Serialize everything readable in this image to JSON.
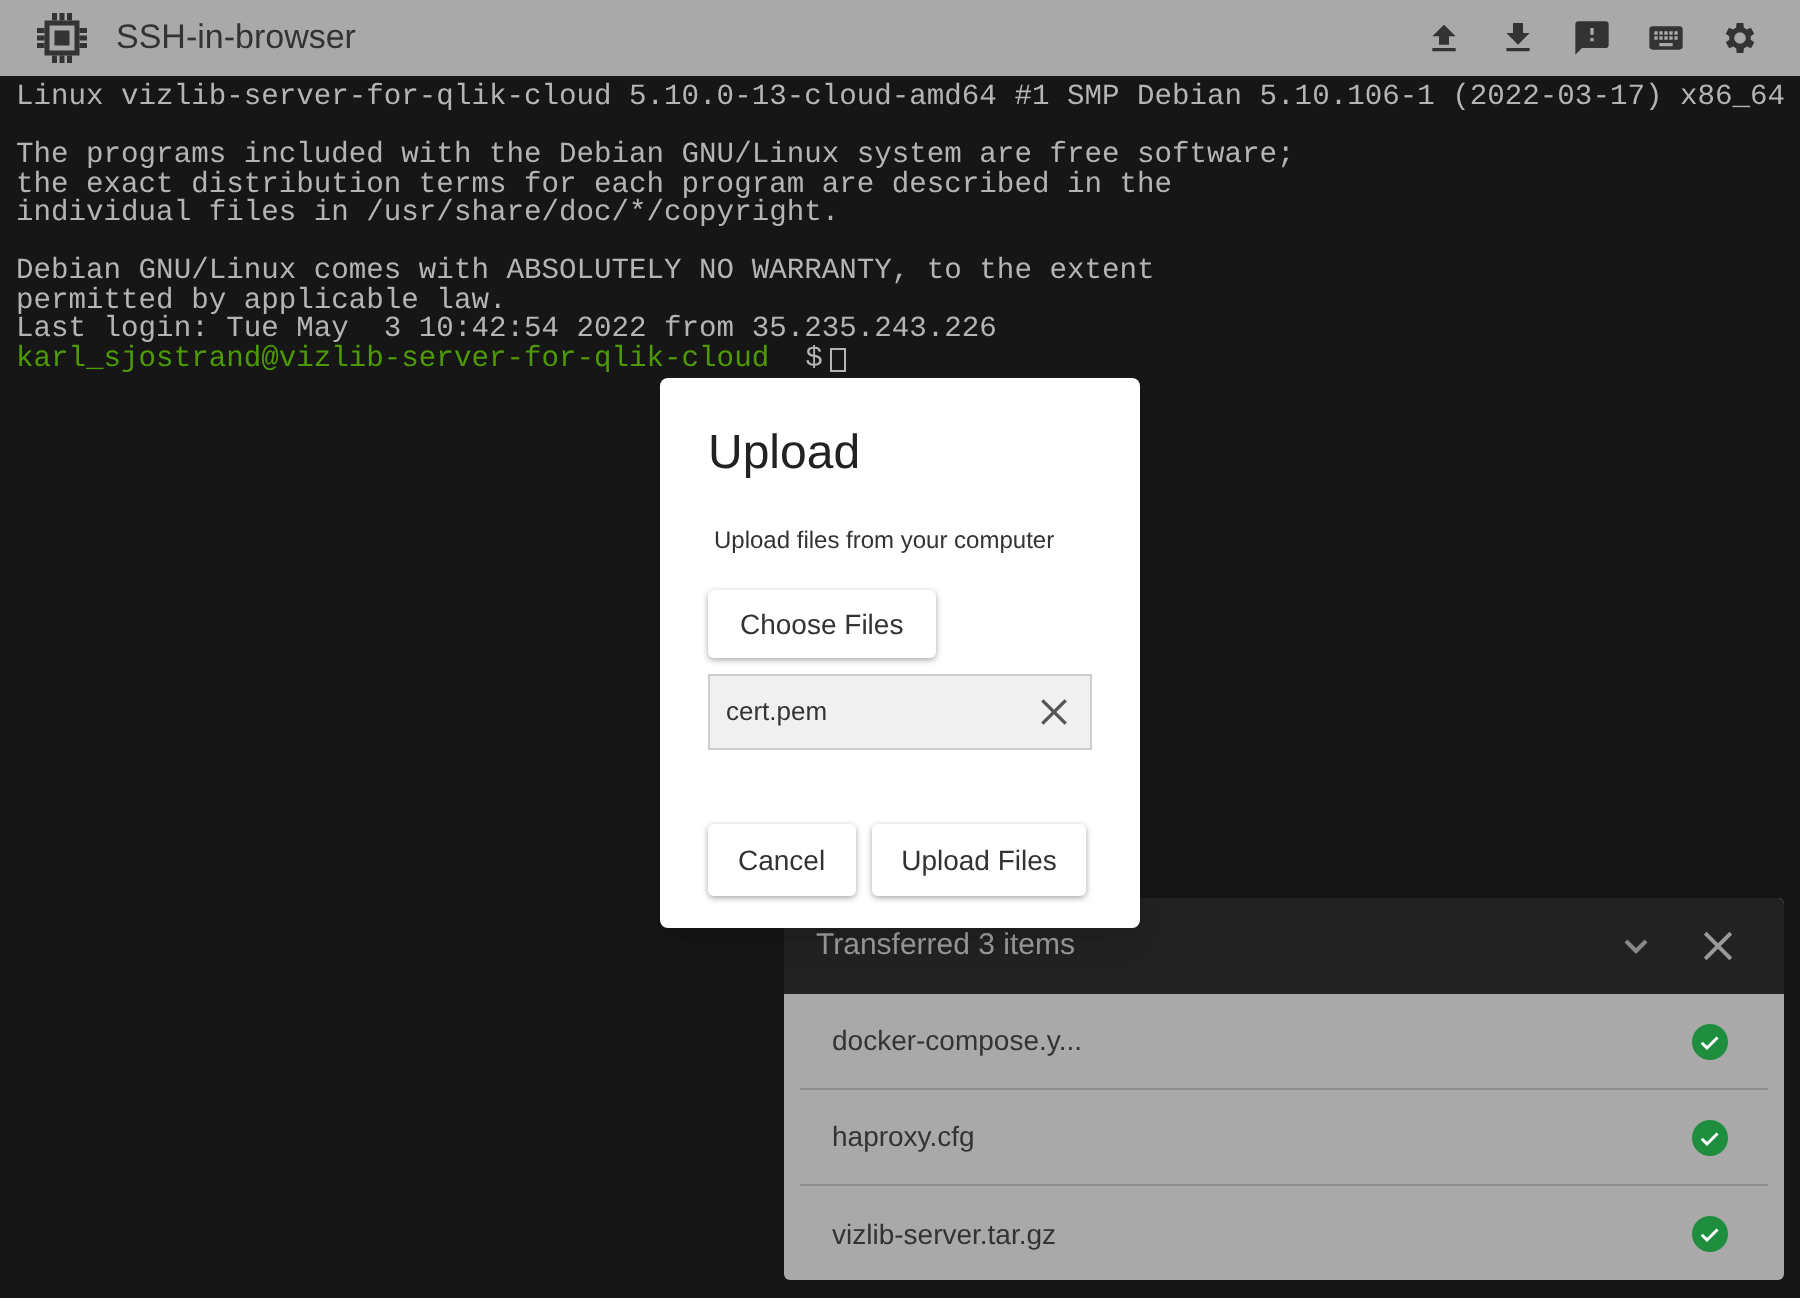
{
  "app_bar": {
    "title": "SSH-in-browser"
  },
  "terminal": {
    "lines": [
      {
        "kind": "output",
        "text": "Linux vizlib-server-for-qlik-cloud 5.10.0-13-cloud-amd64 #1 SMP Debian 5.10.106-1 (2022-03-17) x86_64"
      },
      {
        "kind": "blank"
      },
      {
        "kind": "output",
        "text": "The programs included with the Debian GNU/Linux system are free software;"
      },
      {
        "kind": "output",
        "text": "the exact distribution terms for each program are described in the"
      },
      {
        "kind": "output",
        "text": "individual files in /usr/share/doc/*/copyright."
      },
      {
        "kind": "blank"
      },
      {
        "kind": "output",
        "text": "Debian GNU/Linux comes with ABSOLUTELY NO WARRANTY, to the extent"
      },
      {
        "kind": "output",
        "text": "permitted by applicable law."
      },
      {
        "kind": "output",
        "text": "Last login: Tue May  3 10:42:54 2022 from 35.235.243.226"
      },
      {
        "kind": "prompt",
        "text": "karl_sjostrand@vizlib-server-for-qlik-cloud",
        "tail": "$"
      }
    ]
  },
  "upload_dialog": {
    "title": "Upload",
    "subtitle": "Upload files from your computer",
    "choose_button": "Choose Files",
    "file": {
      "name": "cert.pem"
    },
    "buttons": [
      "Cancel",
      "Upload Files"
    ]
  },
  "transfers": {
    "title": "Transferred 3 items",
    "items": [
      {
        "name": "docker-compose.y...",
        "done": true
      },
      {
        "name": "haproxy.cfg",
        "done": true
      },
      {
        "name": "vizlib-server.tar.gz",
        "done": true
      }
    ]
  }
}
